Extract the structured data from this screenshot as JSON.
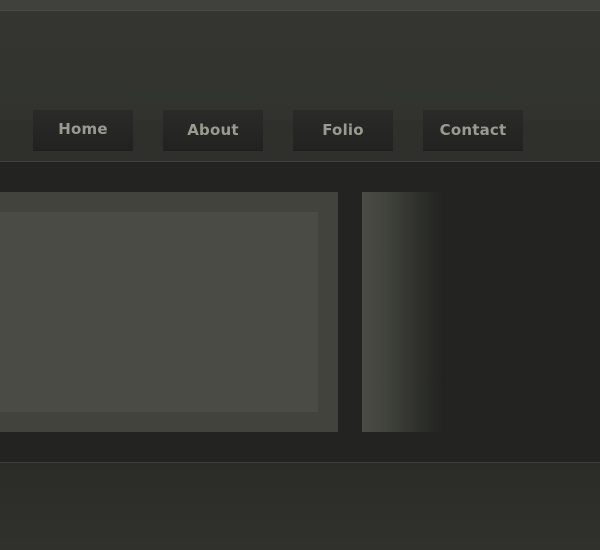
{
  "nav": {
    "items": [
      {
        "label": "Home"
      },
      {
        "label": "About"
      },
      {
        "label": "Folio"
      },
      {
        "label": "Contact"
      }
    ]
  },
  "colors": {
    "background": "#2d2e2a",
    "nav_button": "#252623",
    "nav_text": "#9a9b90",
    "content_band": "#232321",
    "slide_frame": "#42433d",
    "slide_inner": "#4a4b45"
  }
}
